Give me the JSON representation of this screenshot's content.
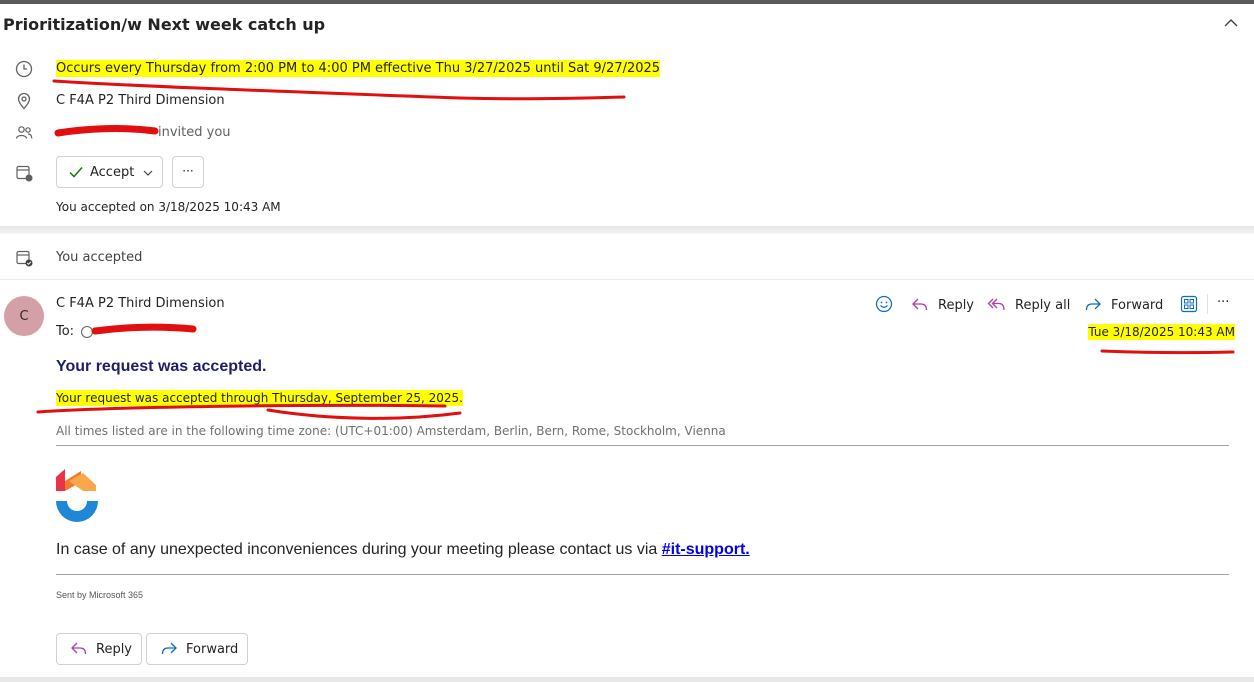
{
  "header": {
    "title": "Prioritization/w Next week catch up"
  },
  "meeting": {
    "recurrence": "Occurs every Thursday from 2:00 PM to 4:00 PM effective Thu 3/27/2025 until Sat 9/27/2025",
    "location": "C F4A P2 Third Dimension",
    "invited_text": "invited you",
    "accept_label": "Accept",
    "more_label": "···",
    "accepted_note": "You accepted on 3/18/2025 10:43 AM"
  },
  "status": {
    "text": "You accepted"
  },
  "message": {
    "avatar_initial": "C",
    "sender": "C F4A P2 Third Dimension",
    "to_label": "To:",
    "date": "Tue 3/18/2025 10:43 AM",
    "actions": {
      "reply": "Reply",
      "reply_all": "Reply all",
      "forward": "Forward",
      "more": "···"
    }
  },
  "body": {
    "heading": "Your request was accepted.",
    "accepted_through": "Your request was accepted through Thursday, September 25, 2025.",
    "timezone": "All times listed are in the following time zone: (UTC+01:00) Amsterdam, Berlin, Bern, Rome, Stockholm, Vienna",
    "support_text": "In case of any unexpected inconveniences during your meeting please contact us via ",
    "support_link": "#it-support.",
    "sent_by": "Sent by Microsoft 365"
  },
  "footer": {
    "reply": "Reply",
    "forward": "Forward"
  },
  "colors": {
    "highlight": "#ffff00",
    "annotation": "#e01010",
    "avatar": "#d4a0a8",
    "reply_icon": "#b13bb0",
    "forward_icon": "#0f6cbd",
    "heading": "#1e1e6e",
    "link": "#0000ee"
  }
}
